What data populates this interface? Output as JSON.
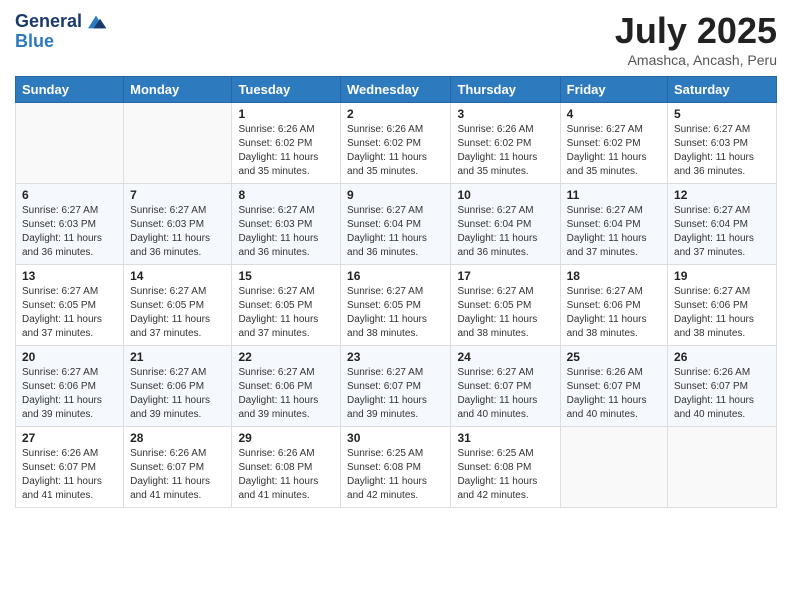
{
  "logo": {
    "line1": "General",
    "line2": "Blue"
  },
  "title": "July 2025",
  "subtitle": "Amashca, Ancash, Peru",
  "days_of_week": [
    "Sunday",
    "Monday",
    "Tuesday",
    "Wednesday",
    "Thursday",
    "Friday",
    "Saturday"
  ],
  "weeks": [
    [
      {
        "day": "",
        "sunrise": "",
        "sunset": "",
        "daylight": ""
      },
      {
        "day": "",
        "sunrise": "",
        "sunset": "",
        "daylight": ""
      },
      {
        "day": "1",
        "sunrise": "Sunrise: 6:26 AM",
        "sunset": "Sunset: 6:02 PM",
        "daylight": "Daylight: 11 hours and 35 minutes."
      },
      {
        "day": "2",
        "sunrise": "Sunrise: 6:26 AM",
        "sunset": "Sunset: 6:02 PM",
        "daylight": "Daylight: 11 hours and 35 minutes."
      },
      {
        "day": "3",
        "sunrise": "Sunrise: 6:26 AM",
        "sunset": "Sunset: 6:02 PM",
        "daylight": "Daylight: 11 hours and 35 minutes."
      },
      {
        "day": "4",
        "sunrise": "Sunrise: 6:27 AM",
        "sunset": "Sunset: 6:02 PM",
        "daylight": "Daylight: 11 hours and 35 minutes."
      },
      {
        "day": "5",
        "sunrise": "Sunrise: 6:27 AM",
        "sunset": "Sunset: 6:03 PM",
        "daylight": "Daylight: 11 hours and 36 minutes."
      }
    ],
    [
      {
        "day": "6",
        "sunrise": "Sunrise: 6:27 AM",
        "sunset": "Sunset: 6:03 PM",
        "daylight": "Daylight: 11 hours and 36 minutes."
      },
      {
        "day": "7",
        "sunrise": "Sunrise: 6:27 AM",
        "sunset": "Sunset: 6:03 PM",
        "daylight": "Daylight: 11 hours and 36 minutes."
      },
      {
        "day": "8",
        "sunrise": "Sunrise: 6:27 AM",
        "sunset": "Sunset: 6:03 PM",
        "daylight": "Daylight: 11 hours and 36 minutes."
      },
      {
        "day": "9",
        "sunrise": "Sunrise: 6:27 AM",
        "sunset": "Sunset: 6:04 PM",
        "daylight": "Daylight: 11 hours and 36 minutes."
      },
      {
        "day": "10",
        "sunrise": "Sunrise: 6:27 AM",
        "sunset": "Sunset: 6:04 PM",
        "daylight": "Daylight: 11 hours and 36 minutes."
      },
      {
        "day": "11",
        "sunrise": "Sunrise: 6:27 AM",
        "sunset": "Sunset: 6:04 PM",
        "daylight": "Daylight: 11 hours and 37 minutes."
      },
      {
        "day": "12",
        "sunrise": "Sunrise: 6:27 AM",
        "sunset": "Sunset: 6:04 PM",
        "daylight": "Daylight: 11 hours and 37 minutes."
      }
    ],
    [
      {
        "day": "13",
        "sunrise": "Sunrise: 6:27 AM",
        "sunset": "Sunset: 6:05 PM",
        "daylight": "Daylight: 11 hours and 37 minutes."
      },
      {
        "day": "14",
        "sunrise": "Sunrise: 6:27 AM",
        "sunset": "Sunset: 6:05 PM",
        "daylight": "Daylight: 11 hours and 37 minutes."
      },
      {
        "day": "15",
        "sunrise": "Sunrise: 6:27 AM",
        "sunset": "Sunset: 6:05 PM",
        "daylight": "Daylight: 11 hours and 37 minutes."
      },
      {
        "day": "16",
        "sunrise": "Sunrise: 6:27 AM",
        "sunset": "Sunset: 6:05 PM",
        "daylight": "Daylight: 11 hours and 38 minutes."
      },
      {
        "day": "17",
        "sunrise": "Sunrise: 6:27 AM",
        "sunset": "Sunset: 6:05 PM",
        "daylight": "Daylight: 11 hours and 38 minutes."
      },
      {
        "day": "18",
        "sunrise": "Sunrise: 6:27 AM",
        "sunset": "Sunset: 6:06 PM",
        "daylight": "Daylight: 11 hours and 38 minutes."
      },
      {
        "day": "19",
        "sunrise": "Sunrise: 6:27 AM",
        "sunset": "Sunset: 6:06 PM",
        "daylight": "Daylight: 11 hours and 38 minutes."
      }
    ],
    [
      {
        "day": "20",
        "sunrise": "Sunrise: 6:27 AM",
        "sunset": "Sunset: 6:06 PM",
        "daylight": "Daylight: 11 hours and 39 minutes."
      },
      {
        "day": "21",
        "sunrise": "Sunrise: 6:27 AM",
        "sunset": "Sunset: 6:06 PM",
        "daylight": "Daylight: 11 hours and 39 minutes."
      },
      {
        "day": "22",
        "sunrise": "Sunrise: 6:27 AM",
        "sunset": "Sunset: 6:06 PM",
        "daylight": "Daylight: 11 hours and 39 minutes."
      },
      {
        "day": "23",
        "sunrise": "Sunrise: 6:27 AM",
        "sunset": "Sunset: 6:07 PM",
        "daylight": "Daylight: 11 hours and 39 minutes."
      },
      {
        "day": "24",
        "sunrise": "Sunrise: 6:27 AM",
        "sunset": "Sunset: 6:07 PM",
        "daylight": "Daylight: 11 hours and 40 minutes."
      },
      {
        "day": "25",
        "sunrise": "Sunrise: 6:26 AM",
        "sunset": "Sunset: 6:07 PM",
        "daylight": "Daylight: 11 hours and 40 minutes."
      },
      {
        "day": "26",
        "sunrise": "Sunrise: 6:26 AM",
        "sunset": "Sunset: 6:07 PM",
        "daylight": "Daylight: 11 hours and 40 minutes."
      }
    ],
    [
      {
        "day": "27",
        "sunrise": "Sunrise: 6:26 AM",
        "sunset": "Sunset: 6:07 PM",
        "daylight": "Daylight: 11 hours and 41 minutes."
      },
      {
        "day": "28",
        "sunrise": "Sunrise: 6:26 AM",
        "sunset": "Sunset: 6:07 PM",
        "daylight": "Daylight: 11 hours and 41 minutes."
      },
      {
        "day": "29",
        "sunrise": "Sunrise: 6:26 AM",
        "sunset": "Sunset: 6:08 PM",
        "daylight": "Daylight: 11 hours and 41 minutes."
      },
      {
        "day": "30",
        "sunrise": "Sunrise: 6:25 AM",
        "sunset": "Sunset: 6:08 PM",
        "daylight": "Daylight: 11 hours and 42 minutes."
      },
      {
        "day": "31",
        "sunrise": "Sunrise: 6:25 AM",
        "sunset": "Sunset: 6:08 PM",
        "daylight": "Daylight: 11 hours and 42 minutes."
      },
      {
        "day": "",
        "sunrise": "",
        "sunset": "",
        "daylight": ""
      },
      {
        "day": "",
        "sunrise": "",
        "sunset": "",
        "daylight": ""
      }
    ]
  ]
}
